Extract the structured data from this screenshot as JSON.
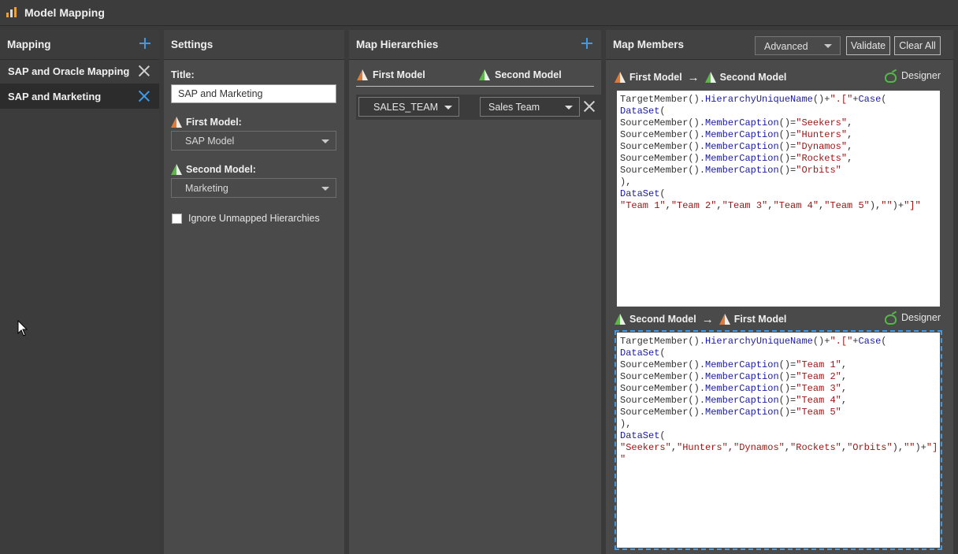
{
  "window": {
    "title": "Model Mapping"
  },
  "mapping": {
    "header": "Mapping",
    "items": [
      {
        "label": "SAP and Oracle Mapping",
        "selected": false
      },
      {
        "label": "SAP and Marketing",
        "selected": true
      }
    ]
  },
  "settings": {
    "header": "Settings",
    "title_label": "Title:",
    "title_value": "SAP and Marketing",
    "first_model_label": "First Model:",
    "first_model_value": "SAP Model",
    "second_model_label": "Second Model:",
    "second_model_value": "Marketing",
    "ignore_label": "Ignore Unmapped Hierarchies"
  },
  "hierarchies": {
    "header": "Map Hierarchies",
    "col_first": "First Model",
    "col_second": "Second Model",
    "rows": [
      {
        "first": "SALES_TEAM",
        "second": "Sales Team"
      }
    ]
  },
  "members": {
    "header": "Map Members",
    "mode": "Advanced",
    "validate_label": "Validate",
    "clear_label": "Clear All",
    "designer_label": "Designer",
    "dir1": {
      "from": "First Model",
      "to": "Second Model"
    },
    "dir2": {
      "from": "Second Model",
      "to": "First Model"
    }
  },
  "colors": {
    "accent": "#3d9be9",
    "first_model": "#e07a3a",
    "second_model": "#5cb648"
  }
}
